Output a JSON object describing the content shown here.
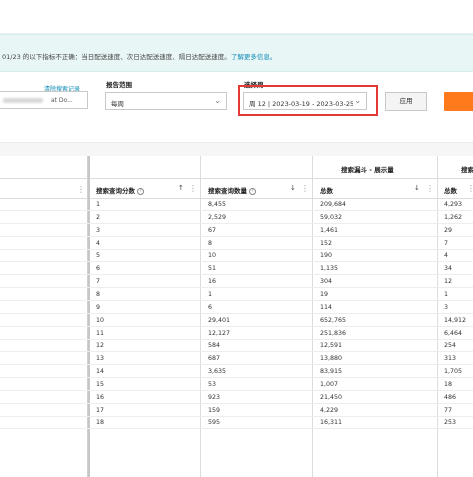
{
  "notice": {
    "text": "01/23 的以下指标不正确：当日配送速度、次日达配送速度、隔日达配送速度。",
    "link": "了解更多信息。"
  },
  "filters": {
    "clear_link": "清除搜索记录",
    "left_input_value": "at Do...",
    "report_range_label": "报告范围",
    "report_range_value": "每周",
    "select_week_label": "选择周",
    "select_week_value": "周 12 | 2023-03-19 - 2023-03-25",
    "apply_label": "应用"
  },
  "table": {
    "group_header": "搜索漏斗 - 展示量",
    "group_header_right": "搜索",
    "columns": {
      "query_score": "搜索查询分数",
      "query_volume": "搜索查询数量",
      "total": "总数",
      "total_right": "总数"
    },
    "rows": [
      {
        "score": "1",
        "volume": "8,455",
        "total": "209,684",
        "right": "4,293"
      },
      {
        "score": "2",
        "volume": "2,529",
        "total": "59,032",
        "right": "1,262"
      },
      {
        "score": "3",
        "volume": "67",
        "total": "1,461",
        "right": "29"
      },
      {
        "score": "4",
        "volume": "8",
        "total": "152",
        "right": "7"
      },
      {
        "score": "5",
        "volume": "10",
        "total": "190",
        "right": "4"
      },
      {
        "score": "6",
        "volume": "51",
        "total": "1,135",
        "right": "34"
      },
      {
        "score": "7",
        "volume": "16",
        "total": "304",
        "right": "12"
      },
      {
        "score": "8",
        "volume": "1",
        "total": "19",
        "right": "1"
      },
      {
        "score": "9",
        "volume": "6",
        "total": "114",
        "right": "3"
      },
      {
        "score": "10",
        "volume": "29,401",
        "total": "652,765",
        "right": "14,912"
      },
      {
        "score": "11",
        "volume": "12,127",
        "total": "251,836",
        "right": "6,464"
      },
      {
        "score": "12",
        "volume": "584",
        "total": "12,591",
        "right": "254"
      },
      {
        "score": "13",
        "volume": "687",
        "total": "13,880",
        "right": "313"
      },
      {
        "score": "14",
        "volume": "3,635",
        "total": "83,915",
        "right": "1,705"
      },
      {
        "score": "15",
        "volume": "53",
        "total": "1,007",
        "right": "18"
      },
      {
        "score": "16",
        "volume": "923",
        "total": "21,450",
        "right": "486"
      },
      {
        "score": "17",
        "volume": "159",
        "total": "4,229",
        "right": "77"
      },
      {
        "score": "18",
        "volume": "595",
        "total": "16,311",
        "right": "253"
      }
    ]
  }
}
